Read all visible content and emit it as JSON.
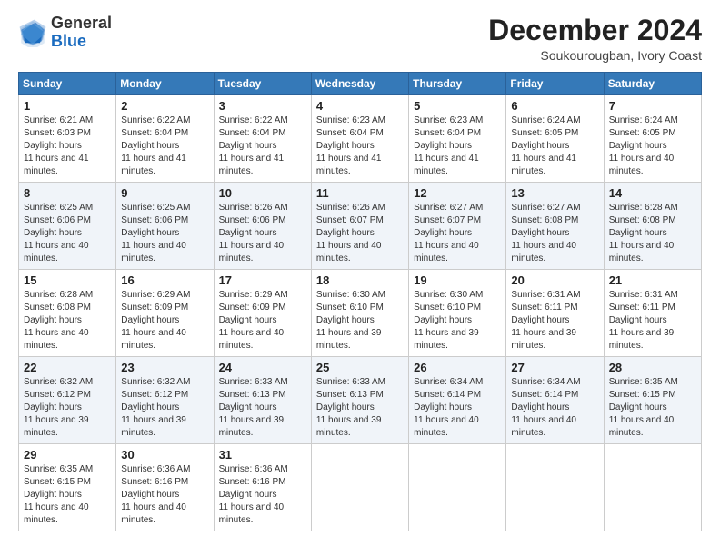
{
  "logo": {
    "general": "General",
    "blue": "Blue"
  },
  "title": "December 2024",
  "location": "Soukourougban, Ivory Coast",
  "days_header": [
    "Sunday",
    "Monday",
    "Tuesday",
    "Wednesday",
    "Thursday",
    "Friday",
    "Saturday"
  ],
  "weeks": [
    [
      {
        "day": "1",
        "sunrise": "6:21 AM",
        "sunset": "6:03 PM",
        "daylight": "11 hours and 41 minutes."
      },
      {
        "day": "2",
        "sunrise": "6:22 AM",
        "sunset": "6:04 PM",
        "daylight": "11 hours and 41 minutes."
      },
      {
        "day": "3",
        "sunrise": "6:22 AM",
        "sunset": "6:04 PM",
        "daylight": "11 hours and 41 minutes."
      },
      {
        "day": "4",
        "sunrise": "6:23 AM",
        "sunset": "6:04 PM",
        "daylight": "11 hours and 41 minutes."
      },
      {
        "day": "5",
        "sunrise": "6:23 AM",
        "sunset": "6:04 PM",
        "daylight": "11 hours and 41 minutes."
      },
      {
        "day": "6",
        "sunrise": "6:24 AM",
        "sunset": "6:05 PM",
        "daylight": "11 hours and 41 minutes."
      },
      {
        "day": "7",
        "sunrise": "6:24 AM",
        "sunset": "6:05 PM",
        "daylight": "11 hours and 40 minutes."
      }
    ],
    [
      {
        "day": "8",
        "sunrise": "6:25 AM",
        "sunset": "6:06 PM",
        "daylight": "11 hours and 40 minutes."
      },
      {
        "day": "9",
        "sunrise": "6:25 AM",
        "sunset": "6:06 PM",
        "daylight": "11 hours and 40 minutes."
      },
      {
        "day": "10",
        "sunrise": "6:26 AM",
        "sunset": "6:06 PM",
        "daylight": "11 hours and 40 minutes."
      },
      {
        "day": "11",
        "sunrise": "6:26 AM",
        "sunset": "6:07 PM",
        "daylight": "11 hours and 40 minutes."
      },
      {
        "day": "12",
        "sunrise": "6:27 AM",
        "sunset": "6:07 PM",
        "daylight": "11 hours and 40 minutes."
      },
      {
        "day": "13",
        "sunrise": "6:27 AM",
        "sunset": "6:08 PM",
        "daylight": "11 hours and 40 minutes."
      },
      {
        "day": "14",
        "sunrise": "6:28 AM",
        "sunset": "6:08 PM",
        "daylight": "11 hours and 40 minutes."
      }
    ],
    [
      {
        "day": "15",
        "sunrise": "6:28 AM",
        "sunset": "6:08 PM",
        "daylight": "11 hours and 40 minutes."
      },
      {
        "day": "16",
        "sunrise": "6:29 AM",
        "sunset": "6:09 PM",
        "daylight": "11 hours and 40 minutes."
      },
      {
        "day": "17",
        "sunrise": "6:29 AM",
        "sunset": "6:09 PM",
        "daylight": "11 hours and 40 minutes."
      },
      {
        "day": "18",
        "sunrise": "6:30 AM",
        "sunset": "6:10 PM",
        "daylight": "11 hours and 39 minutes."
      },
      {
        "day": "19",
        "sunrise": "6:30 AM",
        "sunset": "6:10 PM",
        "daylight": "11 hours and 39 minutes."
      },
      {
        "day": "20",
        "sunrise": "6:31 AM",
        "sunset": "6:11 PM",
        "daylight": "11 hours and 39 minutes."
      },
      {
        "day": "21",
        "sunrise": "6:31 AM",
        "sunset": "6:11 PM",
        "daylight": "11 hours and 39 minutes."
      }
    ],
    [
      {
        "day": "22",
        "sunrise": "6:32 AM",
        "sunset": "6:12 PM",
        "daylight": "11 hours and 39 minutes."
      },
      {
        "day": "23",
        "sunrise": "6:32 AM",
        "sunset": "6:12 PM",
        "daylight": "11 hours and 39 minutes."
      },
      {
        "day": "24",
        "sunrise": "6:33 AM",
        "sunset": "6:13 PM",
        "daylight": "11 hours and 39 minutes."
      },
      {
        "day": "25",
        "sunrise": "6:33 AM",
        "sunset": "6:13 PM",
        "daylight": "11 hours and 39 minutes."
      },
      {
        "day": "26",
        "sunrise": "6:34 AM",
        "sunset": "6:14 PM",
        "daylight": "11 hours and 40 minutes."
      },
      {
        "day": "27",
        "sunrise": "6:34 AM",
        "sunset": "6:14 PM",
        "daylight": "11 hours and 40 minutes."
      },
      {
        "day": "28",
        "sunrise": "6:35 AM",
        "sunset": "6:15 PM",
        "daylight": "11 hours and 40 minutes."
      }
    ],
    [
      {
        "day": "29",
        "sunrise": "6:35 AM",
        "sunset": "6:15 PM",
        "daylight": "11 hours and 40 minutes."
      },
      {
        "day": "30",
        "sunrise": "6:36 AM",
        "sunset": "6:16 PM",
        "daylight": "11 hours and 40 minutes."
      },
      {
        "day": "31",
        "sunrise": "6:36 AM",
        "sunset": "6:16 PM",
        "daylight": "11 hours and 40 minutes."
      },
      null,
      null,
      null,
      null
    ]
  ]
}
